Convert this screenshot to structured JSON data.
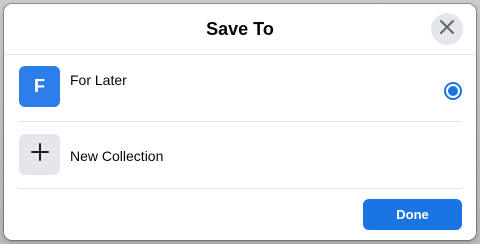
{
  "dialog": {
    "title": "Save To",
    "close_icon": "close-icon"
  },
  "collections": [
    {
      "thumb_letter": "F",
      "label": "For Later",
      "selected": true,
      "thumb_color": "#2d7ee8"
    },
    {
      "icon": "plus-icon",
      "label": "New Collection"
    }
  ],
  "footer": {
    "done_label": "Done"
  },
  "colors": {
    "accent": "#1b74e4"
  }
}
